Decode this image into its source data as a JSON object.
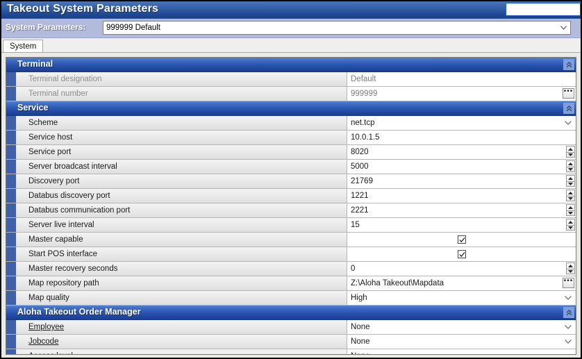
{
  "window": {
    "title": "Takeout System Parameters"
  },
  "param_bar": {
    "label": "System Parameters:",
    "selected": "999999 Default",
    "options": [
      "999999 Default"
    ]
  },
  "tabs": [
    {
      "label": "System",
      "active": true
    }
  ],
  "sections": [
    {
      "id": "terminal",
      "title": "Terminal",
      "collapse_icon": "chevron-double-up-icon",
      "rows": [
        {
          "label": "Terminal designation",
          "value": "Default",
          "control": "text",
          "disabled": true
        },
        {
          "label": "Terminal number",
          "value": "999999",
          "control": "text-ellipsis",
          "disabled": true
        }
      ]
    },
    {
      "id": "service",
      "title": "Service",
      "collapse_icon": "chevron-double-up-icon",
      "rows": [
        {
          "label": "Scheme",
          "value": "net.tcp",
          "control": "dropdown",
          "disabled": false
        },
        {
          "label": "Service host",
          "value": "10.0.1.5",
          "control": "text",
          "disabled": false
        },
        {
          "label": "Service port",
          "value": "8020",
          "control": "spinner",
          "disabled": false
        },
        {
          "label": "Server broadcast interval",
          "value": "5000",
          "control": "spinner",
          "disabled": false
        },
        {
          "label": "Discovery port",
          "value": "21769",
          "control": "spinner",
          "disabled": false
        },
        {
          "label": "Databus discovery port",
          "value": "1221",
          "control": "spinner",
          "disabled": false
        },
        {
          "label": "Databus communication port",
          "value": "2221",
          "control": "spinner",
          "disabled": false
        },
        {
          "label": "Server live interval",
          "value": "15",
          "control": "spinner",
          "disabled": false
        },
        {
          "label": "Master capable",
          "value": "",
          "control": "checkbox",
          "checked": true,
          "disabled": false
        },
        {
          "label": "Start POS interface",
          "value": "",
          "control": "checkbox",
          "checked": true,
          "disabled": false
        },
        {
          "label": "Master recovery seconds",
          "value": "0",
          "control": "spinner",
          "disabled": false
        },
        {
          "label": "Map repository path",
          "value": "Z:\\Aloha Takeout\\Mapdata",
          "control": "text-ellipsis",
          "disabled": false
        },
        {
          "label": "Map quality",
          "value": "High",
          "control": "dropdown",
          "disabled": false
        }
      ]
    },
    {
      "id": "order-manager",
      "title": "Aloha Takeout Order Manager",
      "collapse_icon": "chevron-double-up-icon",
      "rows": [
        {
          "label": "Employee",
          "value": "None",
          "control": "dropdown",
          "link": true,
          "disabled": false
        },
        {
          "label": "Jobcode",
          "value": "None",
          "control": "dropdown",
          "link": true,
          "disabled": false
        },
        {
          "label": "Access level",
          "value": "None",
          "control": "dropdown",
          "link": true,
          "disabled": false
        }
      ]
    }
  ],
  "colors": {
    "title_bar": "#214a94",
    "param_bar": "#b3bbdd",
    "section_header": "#2650ab",
    "row_strip": "#4060a8",
    "row_name_bg": "#e9e9e9"
  }
}
